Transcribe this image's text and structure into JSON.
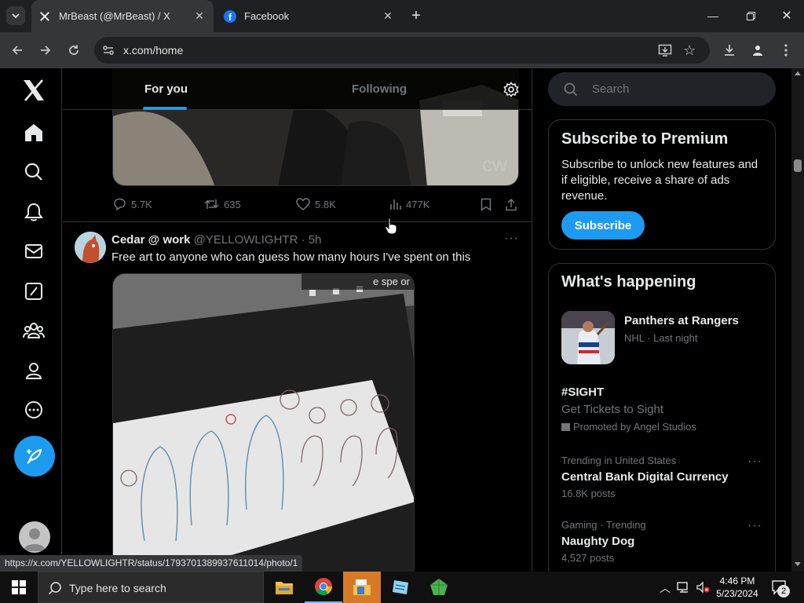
{
  "browser": {
    "tabs": [
      {
        "title": "MrBeast (@MrBeast) / X",
        "active": true,
        "icon": "x-logo-icon"
      },
      {
        "title": "Facebook",
        "active": false,
        "icon": "facebook-icon"
      }
    ],
    "url": "x.com/home",
    "status_url": "https://x.com/YELLOWLIGHTR/status/1793701389937611014/photo/1"
  },
  "x": {
    "tabs": {
      "for_you": "For you",
      "following": "Following"
    },
    "prev_tweet_actions": {
      "replies": "5.7K",
      "reposts": "635",
      "likes": "5.8K",
      "views": "477K"
    },
    "tweet": {
      "name": "Cedar @ work",
      "handle": "@YELLOWLIGHTR",
      "time": "5h",
      "text": "Free art to anyone who can guess how many hours I've spent on this",
      "overlay_text": "e spe    or"
    },
    "search_placeholder": "Search",
    "premium": {
      "title": "Subscribe to Premium",
      "body": "Subscribe to unlock new features and if eligible, receive a share of ads revenue.",
      "button": "Subscribe"
    },
    "happening": {
      "title": "What's happening",
      "items": [
        {
          "title": "Panthers at Rangers",
          "meta": "NHL · Last night"
        },
        {
          "title": "#SIGHT",
          "subtitle": "Get Tickets to Sight",
          "promo": "Promoted by Angel Studios"
        },
        {
          "meta": "Trending in United States",
          "title": "Central Bank Digital Currency",
          "count": "16.8K posts"
        },
        {
          "meta": "Gaming · Trending",
          "title": "Naughty Dog",
          "count": "4,527 posts"
        }
      ]
    }
  },
  "taskbar": {
    "search_placeholder": "Type here to search",
    "time": "4:46 PM",
    "date": "5/23/2024",
    "notification_count": "2"
  },
  "colors": {
    "accent": "#1d9bf0",
    "background": "#000000",
    "border": "#2f3336",
    "muted": "#71767b"
  }
}
